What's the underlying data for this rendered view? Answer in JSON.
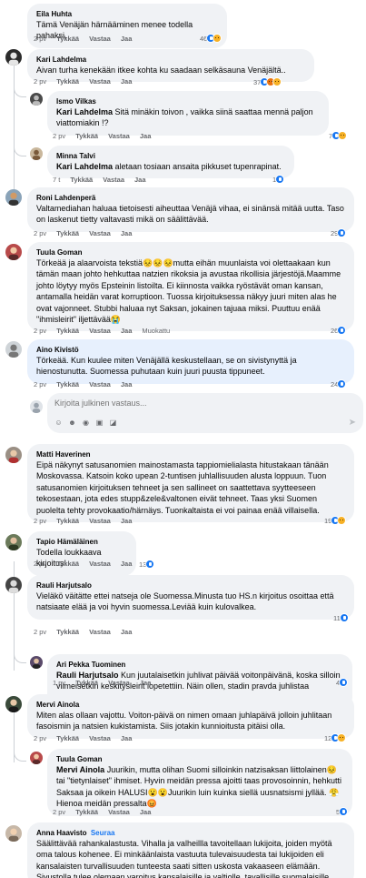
{
  "actions": {
    "like": "Tykkää",
    "reply": "Vastaa",
    "share": "Jaa",
    "edited": "Muokattu"
  },
  "reply_box": {
    "placeholder": "Kirjoita julkinen vastaus..."
  },
  "colors": {
    "bubble": "#f0f2f5",
    "highlight": "#e7f0fd",
    "link": "#1877f2",
    "meta": "#65676b"
  },
  "comments": [
    {
      "author": "Eila Huhta",
      "text": "Tämä Venäjän härnääminen menee todella pahaksi.",
      "time": "2 pv",
      "reactions": "46"
    },
    {
      "author": "Kari Lahdelma",
      "text": "Aivan turha kenekään itkee kohta ku saadaan selkäsauna Venäjältä..",
      "time": "2 pv",
      "reactions": "37"
    },
    {
      "author": "Ismo Vilkas",
      "mention": "Kari Lahdelma",
      "text": " Sitä minäkin toivon , vaikka siinä saattaa mennä paljon viattomiakin !?",
      "time": "2 pv",
      "reactions": "7"
    },
    {
      "author": "Minna Talvi",
      "mention": "Kari Lahdelma",
      "text": " aletaan tosiaan ansaita pikkuset tupenrapinat.",
      "time": "7 t",
      "reactions": "1"
    },
    {
      "author": "Roni Lahdenperä",
      "text": "Valtamediahan haluaa tietoisesti aiheuttaa Venäjä vihaa, ei sinänsä mitää uutta. Taso on laskenut tietty valtavasti mikä on sääli​ttävää.",
      "time": "2 pv",
      "reactions": "29"
    },
    {
      "author": "Tuula Goman",
      "text": "Törkeää ja alaarvoista tekstiä😣😣😣mutta eihän muunlaista voi olettaakaan kun tämän maan johto hehkuttaa natzien rikoksia ja avustaa rikollisia järjestöjä.Maamme johto löytyy myös Epsteinin listoilta. Ei kiinnosta vaikka ryöstävät oman kansan, antamalla heidän varat korruptioon. Tuossa kirjoituksessa näkyy juuri miten alas he ovat vajonneet. Stubbi haluaa nyt Saksan, jokainen tajuaa miksi. Puuttuu enää \"ihmisleirit\" iljettävää😭",
      "time": "2 pv",
      "reactions": "26"
    },
    {
      "author": "Aino Kivistö",
      "text": "Törkeää. Kun kuulee miten Venäjällä keskustellaan, se on sivistynyttä ja hienostunutta. Suomessa puhutaan kuin juuri puusta tippuneet.",
      "time": "2 pv",
      "reactions": "24"
    },
    {
      "author": "Matti Haverinen",
      "text": "Eipä näkynyt satusanomien mainostamasta tappiomielialasta hitustakaan tänään Moskovassa. Katsoin koko upean 2-tuntisen juhlallisuuden alusta loppuun. Tuon satusanomien kirjoituksen tehneet ja sen sallineet on saattettava syytteeseen tekosestaan, jota edes stupp&zele&valtonen eivät tehneet. Taas yksi Suomen puolelta tehty provokaatio/härnäys. Tuonkaltaista ei voi painaa enää villaisella.",
      "time": "2 pv",
      "reactions": "19"
    },
    {
      "author": "Tapio Hämäläinen",
      "text": "Todella loukkaava kirjoitus!",
      "time": "2 pv",
      "reactions": "13"
    },
    {
      "author": "Rauli Harjutsalo",
      "text": "Vieläkö väitätte ettei natseja ole Suomessa.Minusta tuo HS.n kirjoitus osoittaa että natsiaate elää ja voi hyvin suomessa.Leviää kuin kulovalkea.",
      "time": "2 pv",
      "reactions": "11"
    },
    {
      "author": "Ari Pekka Tuominen",
      "mention": "Rauli Harjutsalo",
      "text": " Kun juutalaisetkin juhlivat päivää voitonpäivänä, koska silloin viimeisetkin keskitysleirit lopetettiin. Näin ollen, stadin pravda juhlistaa natsiaatetta pääkirjoituksellaan, jossa tuo päivä olisikin tappion päivä.",
      "time": "1 pv",
      "reactions": "4"
    },
    {
      "author": "Mervi Ainola",
      "text": "Miten alas ollaan vajottu. Voiton-päivä on nimen omaan juhlapäivä jolloin juhlitaan fasoismin ja natsien kukistamista. Siis jotakin kunnioitusta pitäisi olla.",
      "time": "2 pv",
      "reactions": "12"
    },
    {
      "author": "Tuula Goman",
      "mention": "Mervi Ainola",
      "text": " Juurikin, mutta olihan Suomi silloinkin natzisaksan liittolainen😣 tai \"tietynlaiset\" ihmiset. Hyvin meidän pressa ajoitti taas provosoinnin, hehkutti Saksaa ja oikein HALUSI😮😮Juurikin luin kuinka siellä uusnatsismi jyllää. 😤 Hienoa meidän pressalta😡",
      "time": "2 pv",
      "reactions": "5"
    },
    {
      "author": "Anna Haavisto",
      "follow": "Seuraa",
      "text": "Säälittävää rahankalastusta. Vihalla ja valheillla tavoitellaan lukijoita, joiden myötä oma talous kohenee. Ei minkäänlaista vastuuta tulevaisuudesta tai lukijoiden eli kansalaisten turvallisuuden tunteesta saati sitten uskosta vakaaseen elämään. Sivustolla tulee olemaan varoitus kansalaisille ja valtiolle, tavallisille suomalaisille."
    }
  ]
}
